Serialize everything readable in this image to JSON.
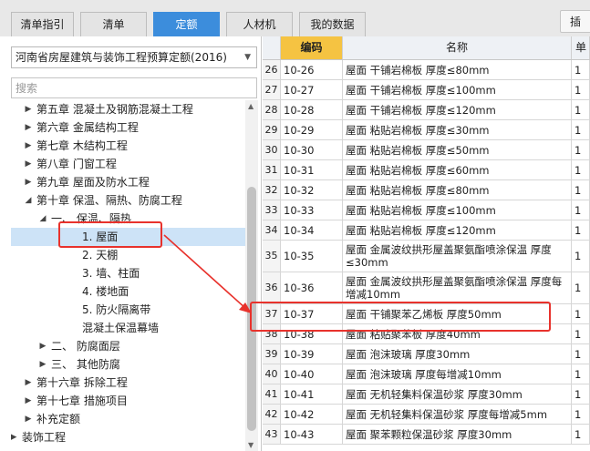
{
  "tabs": [
    {
      "label": "清单指引",
      "active": false
    },
    {
      "label": "清单",
      "active": false
    },
    {
      "label": "定额",
      "active": true
    },
    {
      "label": "人材机",
      "active": false
    },
    {
      "label": "我的数据",
      "active": false
    }
  ],
  "insert_button_label": "插",
  "quota_library": {
    "selected": "河南省房屋建筑与装饰工程预算定额(2016)"
  },
  "search": {
    "placeholder": "搜索"
  },
  "tree": [
    {
      "label": "第五章 混凝土及钢筋混凝土工程",
      "toggle": "▶",
      "selected": false
    },
    {
      "label": "第六章 金属结构工程",
      "toggle": "▶",
      "selected": false
    },
    {
      "label": "第七章 木结构工程",
      "toggle": "▶",
      "selected": false
    },
    {
      "label": "第八章 门窗工程",
      "toggle": "▶",
      "selected": false
    },
    {
      "label": "第九章 屋面及防水工程",
      "toggle": "▶",
      "selected": false
    },
    {
      "label": "第十章 保温、隔热、防腐工程",
      "toggle": "◢",
      "selected": false
    },
    {
      "label": "一、 保温、隔热",
      "toggle": "◢",
      "selected": false
    },
    {
      "label": "1. 屋面",
      "toggle": "",
      "selected": true
    },
    {
      "label": "2. 天棚",
      "toggle": "",
      "selected": false
    },
    {
      "label": "3. 墙、柱面",
      "toggle": "",
      "selected": false
    },
    {
      "label": "4. 楼地面",
      "toggle": "",
      "selected": false
    },
    {
      "label": "5. 防火隔离带",
      "toggle": "",
      "selected": false
    },
    {
      "label": "混凝土保温幕墙",
      "toggle": "",
      "selected": false
    },
    {
      "label": "二、 防腐面层",
      "toggle": "▶",
      "selected": false
    },
    {
      "label": "三、 其他防腐",
      "toggle": "▶",
      "selected": false
    },
    {
      "label": "第十六章 拆除工程",
      "toggle": "▶",
      "selected": false
    },
    {
      "label": "第十七章 措施项目",
      "toggle": "▶",
      "selected": false
    },
    {
      "label": "补充定额",
      "toggle": "▶",
      "selected": false
    },
    {
      "label": "装饰工程",
      "toggle": "▶",
      "selected": false
    }
  ],
  "grid": {
    "headers": [
      "编码",
      "名称",
      "单"
    ],
    "rows": [
      {
        "idx": "26",
        "code": "10-26",
        "name": "屋面 干铺岩棉板 厚度≤80mm",
        "tail": "1"
      },
      {
        "idx": "27",
        "code": "10-27",
        "name": "屋面 干铺岩棉板 厚度≤100mm",
        "tail": "1"
      },
      {
        "idx": "28",
        "code": "10-28",
        "name": "屋面 干铺岩棉板 厚度≤120mm",
        "tail": "1"
      },
      {
        "idx": "29",
        "code": "10-29",
        "name": "屋面 粘贴岩棉板 厚度≤30mm",
        "tail": "1"
      },
      {
        "idx": "30",
        "code": "10-30",
        "name": "屋面 粘贴岩棉板 厚度≤50mm",
        "tail": "1"
      },
      {
        "idx": "31",
        "code": "10-31",
        "name": "屋面 粘贴岩棉板 厚度≤60mm",
        "tail": "1"
      },
      {
        "idx": "32",
        "code": "10-32",
        "name": "屋面 粘贴岩棉板 厚度≤80mm",
        "tail": "1"
      },
      {
        "idx": "33",
        "code": "10-33",
        "name": "屋面 粘贴岩棉板 厚度≤100mm",
        "tail": "1"
      },
      {
        "idx": "34",
        "code": "10-34",
        "name": "屋面 粘贴岩棉板 厚度≤120mm",
        "tail": "1"
      },
      {
        "idx": "35",
        "code": "10-35",
        "name": "屋面 金属波纹拱形屋盖聚氨酯喷涂保温 厚度≤30mm",
        "tail": "1"
      },
      {
        "idx": "36",
        "code": "10-36",
        "name": "屋面 金属波纹拱形屋盖聚氨酯喷涂保温 厚度每增减10mm",
        "tail": "1"
      },
      {
        "idx": "37",
        "code": "10-37",
        "name": "屋面 干铺聚苯乙烯板 厚度50mm",
        "tail": "1"
      },
      {
        "idx": "38",
        "code": "10-38",
        "name": "屋面 粘贴聚苯板 厚度40mm",
        "tail": "1"
      },
      {
        "idx": "39",
        "code": "10-39",
        "name": "屋面 泡沫玻璃 厚度30mm",
        "tail": "1"
      },
      {
        "idx": "40",
        "code": "10-40",
        "name": "屋面 泡沫玻璃 厚度每增减10mm",
        "tail": "1"
      },
      {
        "idx": "41",
        "code": "10-41",
        "name": "屋面 无机轻集料保温砂浆 厚度30mm",
        "tail": "1"
      },
      {
        "idx": "42",
        "code": "10-42",
        "name": "屋面 无机轻集料保温砂浆 厚度每增减5mm",
        "tail": "1"
      },
      {
        "idx": "43",
        "code": "10-43",
        "name": "屋面 聚苯颗粒保温砂浆 厚度30mm",
        "tail": "1"
      }
    ]
  }
}
